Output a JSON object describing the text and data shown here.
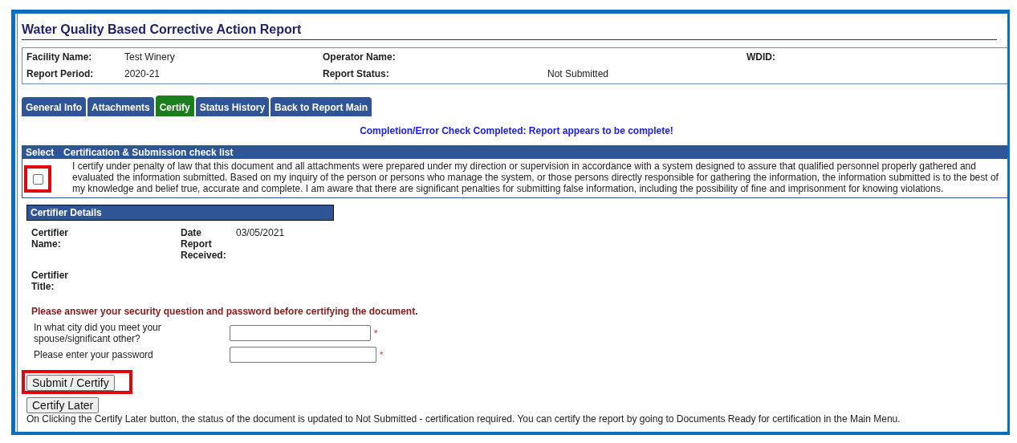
{
  "report": {
    "title": "Water Quality Based Corrective Action Report"
  },
  "facility": {
    "rows": [
      [
        {
          "label": "Facility Name:",
          "value": "Test Winery"
        },
        {
          "label": "Operator Name:"
        },
        {
          "label": "WDID:"
        }
      ],
      [
        {
          "label": "Report Period:",
          "value": "2020-21"
        },
        {
          "label": "Report Status:",
          "value": "Not Submitted"
        }
      ]
    ]
  },
  "tabs": [
    {
      "label": "General Info",
      "selected": false
    },
    {
      "label": "Attachments",
      "selected": false
    },
    {
      "label": "Certify",
      "selected": true
    },
    {
      "label": "Status History",
      "selected": false
    },
    {
      "label": "Back to Report Main",
      "selected": false
    }
  ],
  "status_message": "Completion/Error Check Completed: Report appears to be complete!",
  "checklist": {
    "columns": [
      "Select",
      "Certification & Submission check list"
    ],
    "items": [
      {
        "checked": false,
        "highlighted": true,
        "text": "I certify under penalty of law that this document and all attachments were prepared under my direction or supervision in accordance with a system designed to assure that qualified personnel properly gathered and evaluated the information submitted. Based on my inquiry of the person or persons who manage the system, or those persons directly responsible for gathering the information, the information submitted is to the best of my knowledge and belief true, accurate and complete. I am aware that there are significant penalties for submitting false information, including the possibility of fine and imprisonment for knowing violations."
      }
    ]
  },
  "certifier": {
    "title": "Certifier Details",
    "rows": [
      [
        {
          "label": "Certifier Name:"
        },
        {
          "label": "Date Report Received:",
          "value": "03/05/2021"
        }
      ],
      [
        {
          "label": "Certifier Title:"
        }
      ]
    ]
  },
  "security": {
    "prompt": "Please answer your security question and password before certifying the document.",
    "questions": [
      {
        "label": "In what city did you meet your spouse/significant other?",
        "required_mark": "*",
        "kind": "text"
      },
      {
        "label": "Please enter your password",
        "required_mark": "*",
        "kind": "password"
      }
    ]
  },
  "buttons": [
    {
      "label": "Submit / Certify",
      "highlighted": true
    },
    {
      "label": "Certify Later",
      "highlighted": false
    }
  ],
  "note": "On Clicking the Certify Later button, the status of the document is updated to Not Submitted - certification required. You can certify the report by going to Documents Ready for certification in the Main Menu."
}
